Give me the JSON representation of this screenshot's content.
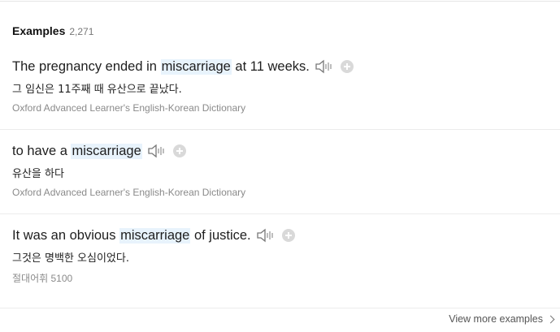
{
  "header": {
    "title": "Examples",
    "count": "2,271"
  },
  "examples": [
    {
      "before": "The pregnancy ended in ",
      "keyword": "miscarriage",
      "after": " at 11 weeks.",
      "translation": "그 임신은 11주째 때 유산으로 끝났다.",
      "source": "Oxford Advanced Learner's English-Korean Dictionary"
    },
    {
      "before": "to have a ",
      "keyword": "miscarriage",
      "after": "",
      "translation": "유산을 하다",
      "source": "Oxford Advanced Learner's English-Korean Dictionary"
    },
    {
      "before": "It was an obvious ",
      "keyword": "miscarriage",
      "after": " of justice.",
      "translation": "그것은 명백한 오심이었다.",
      "source": "절대어휘 5100"
    }
  ],
  "icons": {
    "audio": "speaker-icon",
    "add": "plus-circle-icon",
    "more": "chevron-right-icon"
  },
  "footer": {
    "more_label": "View more examples"
  },
  "colors": {
    "highlight": "#e8f3fc",
    "add_button": "#d9d9d9"
  }
}
